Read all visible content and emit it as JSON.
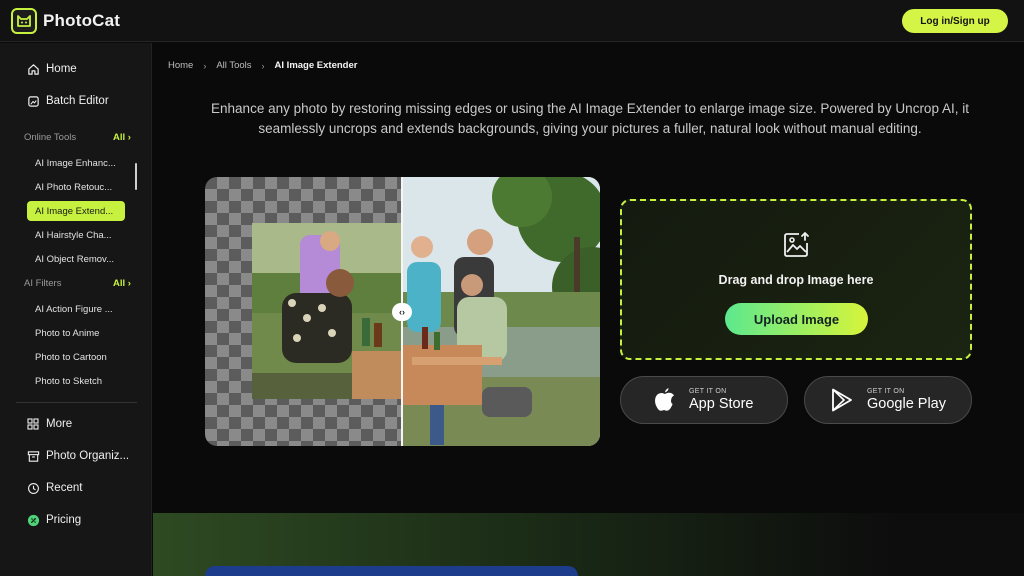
{
  "brand": {
    "name": "PhotoCat",
    "accent": "#c6f23f"
  },
  "header": {
    "login_label": "Log in/Sign up"
  },
  "sidebar": {
    "top_items": [
      {
        "label": "Home",
        "icon": "home-icon"
      },
      {
        "label": "Batch Editor",
        "icon": "batch-icon"
      }
    ],
    "online_tools": {
      "label": "Online Tools",
      "all_label": "All",
      "items": [
        "AI Image Enhanc...",
        "AI Photo Retouc...",
        "AI Image Extend...",
        "AI Hairstyle Cha...",
        "AI Object Remov..."
      ],
      "active_index": 2
    },
    "ai_filters": {
      "label": "AI Filters",
      "all_label": "All",
      "items": [
        "AI Action Figure ...",
        "Photo to Anime",
        "Photo to Cartoon",
        "Photo to Sketch"
      ]
    },
    "bottom_items": [
      {
        "label": "More",
        "icon": "grid-icon"
      },
      {
        "label": "Photo Organiz...",
        "icon": "archive-icon"
      },
      {
        "label": "Recent",
        "icon": "clock-icon"
      },
      {
        "label": "Pricing",
        "icon": "pricing-icon"
      }
    ]
  },
  "breadcrumb": {
    "items": [
      "Home",
      "All Tools",
      "AI Image Extender"
    ]
  },
  "main": {
    "description": "Enhance any photo by restoring missing edges or using the AI Image Extender to enlarge image size. Powered by Uncrop AI, it seamlessly uncrops and extends backgrounds, giving your pictures a fuller, natural look without manual editing."
  },
  "upload": {
    "drag_text": "Drag and drop Image here",
    "button_label": "Upload Image"
  },
  "stores": [
    {
      "small": "GET IT ON",
      "big": "App Store",
      "icon": "apple-icon"
    },
    {
      "small": "GET IT ON",
      "big": "Google Play",
      "icon": "google-play-icon"
    }
  ]
}
